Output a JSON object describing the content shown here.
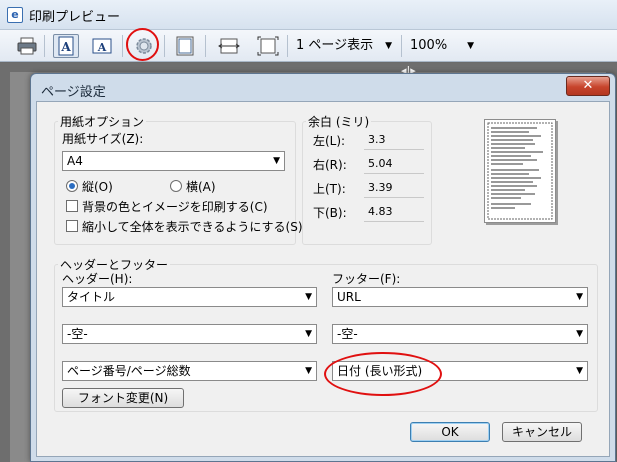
{
  "window": {
    "title": "印刷プレビュー",
    "icon": "ie-page-icon"
  },
  "toolbar": {
    "buttons": [
      {
        "name": "print-icon"
      },
      {
        "name": "portrait-icon",
        "glyph": "A"
      },
      {
        "name": "landscape-icon",
        "glyph": "A"
      },
      {
        "name": "page-setup-gear-icon"
      },
      {
        "name": "header-footer-icon"
      },
      {
        "name": "full-width-icon"
      },
      {
        "name": "full-page-icon"
      }
    ],
    "page_view": "1 ページ表示",
    "zoom": "100%"
  },
  "dialog": {
    "title": "ページ設定",
    "close_glyph": "✕",
    "paper_options": {
      "label": "用紙オプション",
      "size_label": "用紙サイズ(Z):",
      "size_value": "A4",
      "portrait": "縦(O)",
      "landscape": "横(A)",
      "orientation_selected": "portrait",
      "print_bg": "背景の色とイメージを印刷する(C)",
      "print_bg_checked": false,
      "shrink": "縮小して全体を表示できるようにする(S)",
      "shrink_checked": false
    },
    "margins": {
      "label": "余白 (ミリ)",
      "left_label": "左(L):",
      "left_value": "3.3",
      "right_label": "右(R):",
      "right_value": "5.04",
      "top_label": "上(T):",
      "top_value": "3.39",
      "bottom_label": "下(B):",
      "bottom_value": "4.83"
    },
    "header_footer": {
      "label": "ヘッダーとフッター",
      "header_label": "ヘッダー(H):",
      "footer_label": "フッター(F):",
      "header_1": "タイトル",
      "header_2": "-空-",
      "header_3": "ページ番号/ページ総数",
      "footer_1": "URL",
      "footer_2": "-空-",
      "footer_3": "日付 (長い形式)",
      "font_button": "フォント変更(N)"
    },
    "ok": "OK",
    "cancel": "キャンセル"
  },
  "colors": {
    "highlight_ring": "#e01010",
    "dialog_frame": "#cfdcea",
    "close_button": "#c7442c"
  }
}
